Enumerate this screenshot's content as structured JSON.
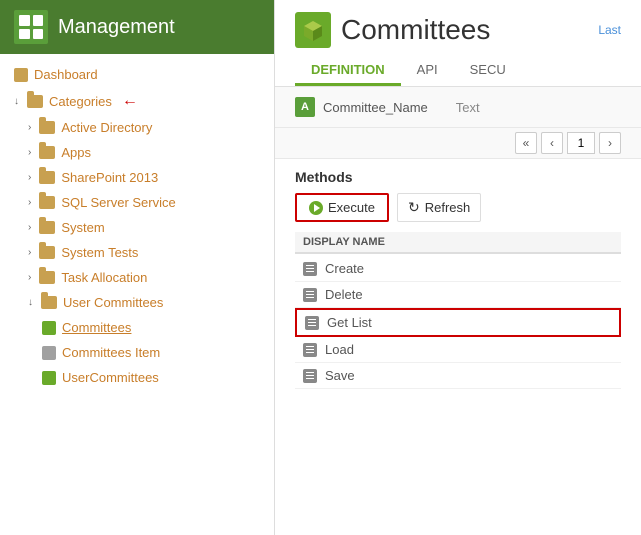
{
  "app": {
    "title": "Management"
  },
  "sidebar": {
    "dashboard_label": "Dashboard",
    "categories_label": "Categories",
    "items": [
      {
        "label": "Active Directory",
        "indent": 1,
        "type": "folder"
      },
      {
        "label": "Apps",
        "indent": 1,
        "type": "folder"
      },
      {
        "label": "SharePoint 2013",
        "indent": 1,
        "type": "folder"
      },
      {
        "label": "SQL Server Service",
        "indent": 1,
        "type": "folder"
      },
      {
        "label": "System",
        "indent": 1,
        "type": "folder"
      },
      {
        "label": "System Tests",
        "indent": 1,
        "type": "folder"
      },
      {
        "label": "Task Allocation",
        "indent": 1,
        "type": "folder"
      },
      {
        "label": "User Committees",
        "indent": 1,
        "type": "folder",
        "expanded": true
      },
      {
        "label": "Committees",
        "indent": 2,
        "type": "cube",
        "active": true
      },
      {
        "label": "Committees Item",
        "indent": 2,
        "type": "grid"
      },
      {
        "label": "UserCommittees",
        "indent": 2,
        "type": "cube"
      }
    ]
  },
  "main": {
    "title": "Committees",
    "last_label": "Last",
    "tabs": [
      {
        "label": "DEFINITION",
        "active": true
      },
      {
        "label": "API",
        "active": false
      },
      {
        "label": "SECU",
        "active": false
      }
    ],
    "field": {
      "icon": "A",
      "name": "Committee_Name",
      "type": "Text"
    },
    "pagination": {
      "page": "1"
    },
    "methods_title": "Methods",
    "execute_label": "Execute",
    "refresh_label": "Refresh",
    "display_name_col": "DISPLAY NAME",
    "methods": [
      {
        "name": "Create",
        "highlighted": false
      },
      {
        "name": "Delete",
        "highlighted": false
      },
      {
        "name": "Get List",
        "highlighted": true
      },
      {
        "name": "Load",
        "highlighted": false
      },
      {
        "name": "Save",
        "highlighted": false
      }
    ]
  },
  "icons": {
    "play": "▶",
    "refresh": "↻",
    "folder": "📁",
    "chevron_right": "›",
    "chevron_left": "‹",
    "chevron_double_left": "«",
    "chevron_down": "∨",
    "arrow_right": "→"
  }
}
